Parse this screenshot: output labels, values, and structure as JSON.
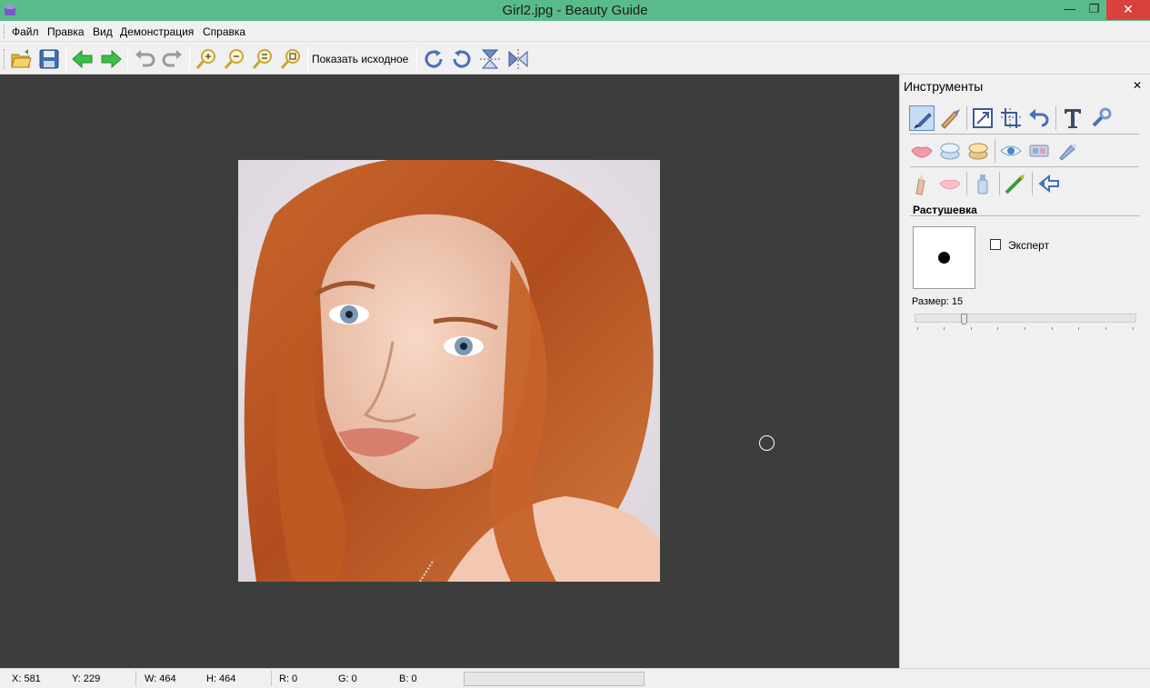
{
  "window": {
    "title": "Girl2.jpg - Beauty Guide",
    "min_glyph": "—",
    "max_glyph": "❐",
    "close_glyph": "✕"
  },
  "menu": [
    "Файл",
    "Правка",
    "Вид",
    "Демонстрация",
    "Справка"
  ],
  "toolbar": {
    "buttons": [
      "open-icon",
      "save-icon",
      "back-arrow-icon",
      "forward-arrow-icon",
      "undo-icon",
      "redo-icon",
      "zoom-in-icon",
      "zoom-out-icon",
      "zoom-fit-icon",
      "zoom-actual-icon",
      "rotate-cw-icon",
      "rotate-ccw-icon",
      "flip-vertical-icon",
      "flip-horizontal-icon"
    ],
    "show_original": "Показать исходное"
  },
  "panel": {
    "title": "Инструменты",
    "close_glyph": "✕",
    "row1": [
      "brush-icon",
      "eraser-brush-icon",
      "resize-icon",
      "crop-icon",
      "undo-arrow-icon",
      "text-icon",
      "wrench-icon"
    ],
    "row2": [
      "lips-icon",
      "foundation-icon",
      "powder-icon",
      "eye-icon",
      "eyeshadow-icon",
      "pencil-makeup-icon"
    ],
    "row3": [
      "pencil-icon",
      "lips-gloss-icon",
      "bottle-icon",
      "mascara-icon",
      "back-tool-icon"
    ],
    "section": "Растушевка",
    "expert_label": "Эксперт",
    "expert_checked": false,
    "size_label": "Размер: 15",
    "size_value": 15,
    "size_max": 100
  },
  "status": {
    "x": "X: 581",
    "y": "Y: 229",
    "w": "W: 464",
    "h": "H: 464",
    "r": "R: 0",
    "g": "G: 0",
    "b": "B: 0",
    "progress": 0
  },
  "colors": {
    "titlebar": "#5abb8a",
    "canvas": "#3d3d3d",
    "close": "#d9423c"
  }
}
